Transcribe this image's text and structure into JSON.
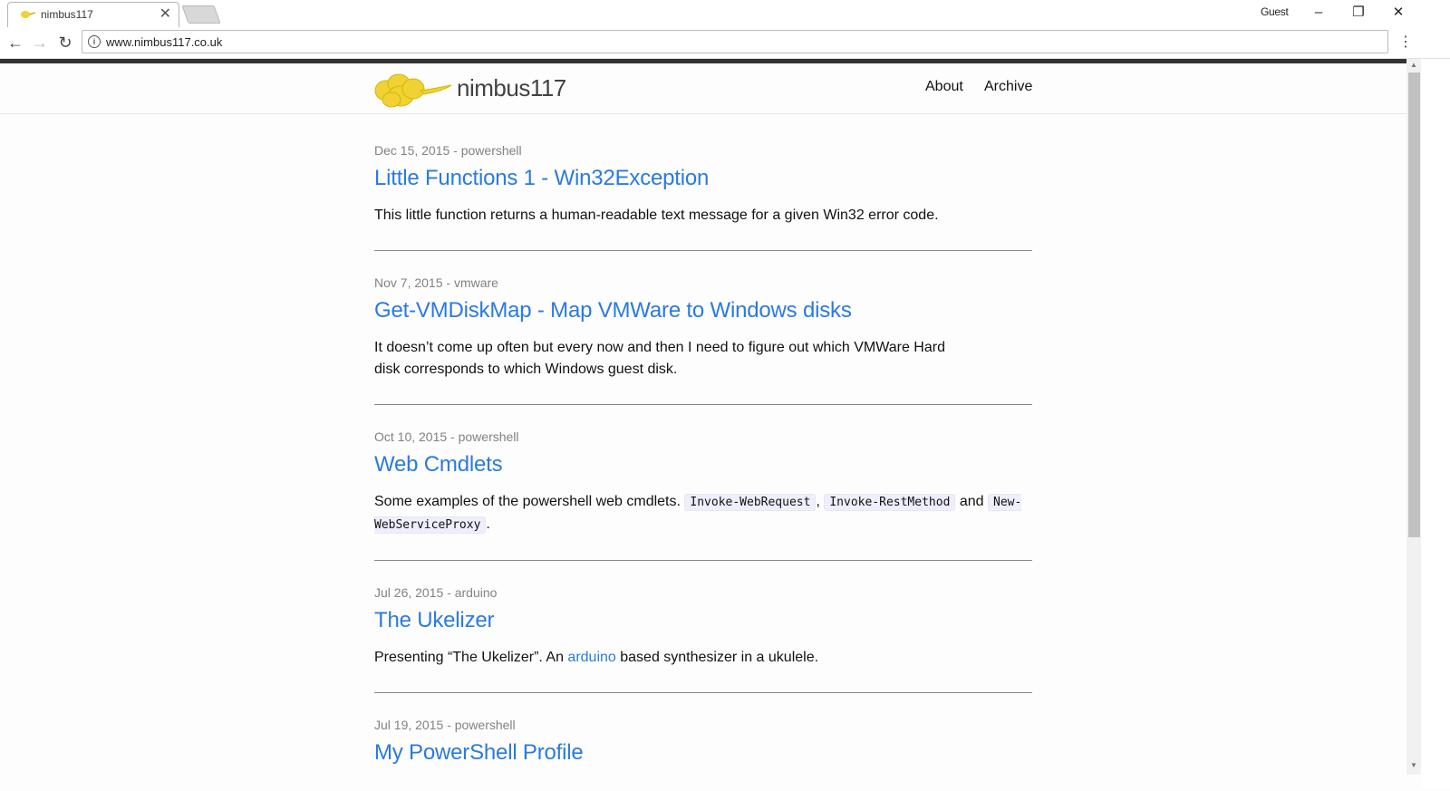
{
  "browser": {
    "tab_title": "nimbus117",
    "tab_close": "✕",
    "profile_label": "Guest",
    "url": "www.nimbus117.co.uk",
    "info_icon": "i",
    "back_icon": "←",
    "forward_icon": "→",
    "reload_icon": "↻",
    "minimize_icon": "–",
    "restore_icon": "❐",
    "close_icon": "✕",
    "menu_icon": "⋮"
  },
  "site": {
    "title": "nimbus117",
    "logo_color": "#f0d234",
    "nav": [
      {
        "label": "About"
      },
      {
        "label": "Archive"
      }
    ]
  },
  "posts": [
    {
      "meta": "Dec 15, 2015 - powershell",
      "title": "Little Functions 1 - Win32Exception",
      "excerpt": "This little function returns a human-readable text message for a given Win32 error code."
    },
    {
      "meta": "Nov 7, 2015 - vmware",
      "title": "Get-VMDiskMap - Map VMWare to Windows disks",
      "excerpt": "It doesn’t come up often but every now and then I need to figure out which VMWare Hard disk corresponds to which Windows guest disk."
    },
    {
      "meta": "Oct 10, 2015 - powershell",
      "title": "Web Cmdlets",
      "excerpt_parts": {
        "intro": "Some examples of the powershell web cmdlets. ",
        "code1": "Invoke-WebRequest",
        "sep1": ", ",
        "code2": "Invoke-RestMethod",
        "sep2": " and ",
        "code3": "New-WebServiceProxy",
        "end": "."
      }
    },
    {
      "meta": "Jul 26, 2015 - arduino",
      "title": "The Ukelizer",
      "excerpt_parts": {
        "intro": "Presenting “The Ukelizer”. An ",
        "link": "arduino",
        "end": " based synthesizer in a ukulele."
      }
    },
    {
      "meta": "Jul 19, 2015 - powershell",
      "title": "My PowerShell Profile"
    }
  ]
}
